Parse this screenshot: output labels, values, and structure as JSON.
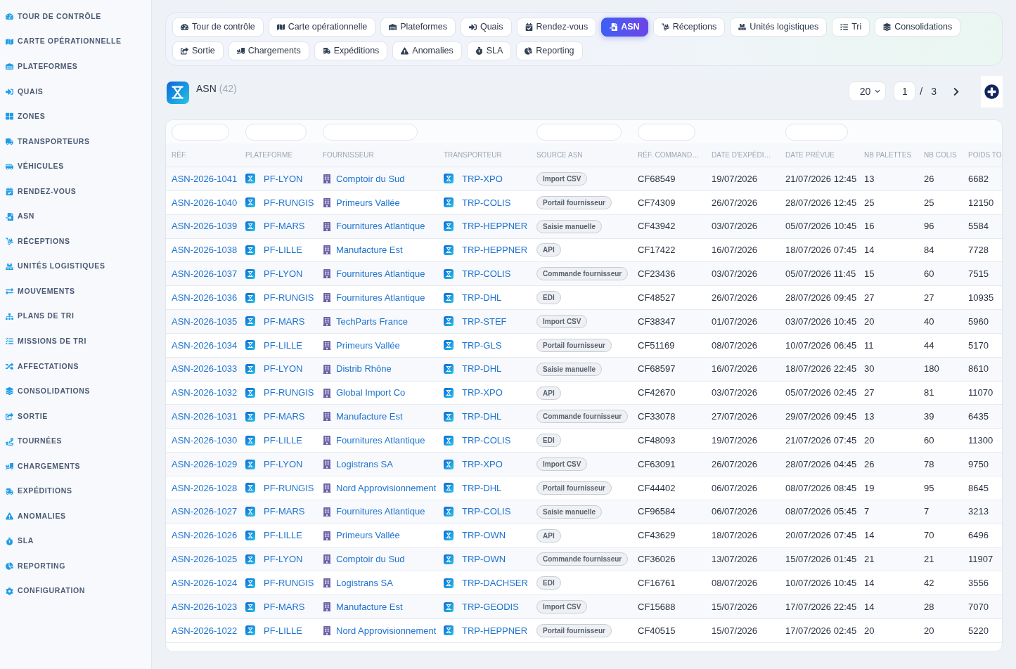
{
  "sidebar": {
    "items": [
      "TOUR DE CONTRÔLE",
      "CARTE OPÉRATIONNELLE",
      "PLATEFORMES",
      "QUAIS",
      "ZONES",
      "TRANSPORTEURS",
      "VÉHICULES",
      "RENDEZ-VOUS",
      "ASN",
      "RÉCEPTIONS",
      "UNITÉS LOGISTIQUES",
      "MOUVEMENTS",
      "PLANS DE TRI",
      "MISSIONS DE TRI",
      "AFFECTATIONS",
      "CONSOLIDATIONS",
      "SORTIE",
      "TOURNÉES",
      "CHARGEMENTS",
      "EXPÉDITIONS",
      "ANOMALIES",
      "SLA",
      "REPORTING",
      "CONFIGURATION"
    ]
  },
  "tabs": [
    {
      "label": "Tour de contrôle",
      "selected": false
    },
    {
      "label": "Carte opérationnelle",
      "selected": false
    },
    {
      "label": "Plateformes",
      "selected": false
    },
    {
      "label": "Quais",
      "selected": false
    },
    {
      "label": "Rendez-vous",
      "selected": false
    },
    {
      "label": "ASN",
      "selected": true
    },
    {
      "label": "Réceptions",
      "selected": false
    },
    {
      "label": "Unités logistiques",
      "selected": false
    },
    {
      "label": "Tri",
      "selected": false
    },
    {
      "label": "Consolidations",
      "selected": false
    },
    {
      "label": "Sortie",
      "selected": false
    },
    {
      "label": "Chargements",
      "selected": false
    },
    {
      "label": "Expéditions",
      "selected": false
    },
    {
      "label": "Anomalies",
      "selected": false
    },
    {
      "label": "SLA",
      "selected": false
    },
    {
      "label": "Reporting",
      "selected": false
    }
  ],
  "header": {
    "title": "ASN",
    "count": "(42)",
    "page_size": "20",
    "page": "1",
    "page_separator": "/",
    "page_total": "3"
  },
  "table": {
    "columns": [
      {
        "label": "RÉF.",
        "filter": true
      },
      {
        "label": "PLATEFORME",
        "filter": true
      },
      {
        "label": "FOURNISSEUR",
        "filter": true
      },
      {
        "label": "TRANSPORTEUR",
        "filter": false
      },
      {
        "label": "SOURCE ASN",
        "filter": true
      },
      {
        "label": "RÉF. COMMAND…",
        "filter": true
      },
      {
        "label": "DATE D'EXPÉDI…",
        "filter": false
      },
      {
        "label": "DATE PRÉVUE",
        "filter": true
      },
      {
        "label": "NB PALETTES",
        "filter": false
      },
      {
        "label": "NB COLIS",
        "filter": false
      },
      {
        "label": "POIDS TO",
        "filter": false
      }
    ],
    "rows": [
      {
        "ref": "ASN-2026-1041",
        "platform": "PF-LYON",
        "supplier": "Comptoir du Sud",
        "carrier": "TRP-XPO",
        "source": "Import CSV",
        "order_ref": "CF68549",
        "ship_date": "19/07/2026",
        "due_date": "21/07/2026 12:45",
        "pallets": "13",
        "parcels": "26",
        "weight": "6682"
      },
      {
        "ref": "ASN-2026-1040",
        "platform": "PF-RUNGIS",
        "supplier": "Primeurs Vallée",
        "carrier": "TRP-COLIS",
        "source": "Portail fournisseur",
        "order_ref": "CF74309",
        "ship_date": "26/07/2026",
        "due_date": "28/07/2026 12:45",
        "pallets": "25",
        "parcels": "25",
        "weight": "12150"
      },
      {
        "ref": "ASN-2026-1039",
        "platform": "PF-MARS",
        "supplier": "Fournitures Atlantique",
        "carrier": "TRP-HEPPNER",
        "source": "Saisie manuelle",
        "order_ref": "CF43942",
        "ship_date": "03/07/2026",
        "due_date": "05/07/2026 10:45",
        "pallets": "16",
        "parcels": "96",
        "weight": "5584"
      },
      {
        "ref": "ASN-2026-1038",
        "platform": "PF-LILLE",
        "supplier": "Manufacture Est",
        "carrier": "TRP-HEPPNER",
        "source": "API",
        "order_ref": "CF17422",
        "ship_date": "16/07/2026",
        "due_date": "18/07/2026 07:45",
        "pallets": "14",
        "parcels": "84",
        "weight": "7728"
      },
      {
        "ref": "ASN-2026-1037",
        "platform": "PF-LYON",
        "supplier": "Fournitures Atlantique",
        "carrier": "TRP-COLIS",
        "source": "Commande fournisseur",
        "order_ref": "CF23436",
        "ship_date": "03/07/2026",
        "due_date": "05/07/2026 11:45",
        "pallets": "15",
        "parcels": "60",
        "weight": "7515"
      },
      {
        "ref": "ASN-2026-1036",
        "platform": "PF-RUNGIS",
        "supplier": "Fournitures Atlantique",
        "carrier": "TRP-DHL",
        "source": "EDI",
        "order_ref": "CF48527",
        "ship_date": "26/07/2026",
        "due_date": "28/07/2026 09:45",
        "pallets": "27",
        "parcels": "27",
        "weight": "10935"
      },
      {
        "ref": "ASN-2026-1035",
        "platform": "PF-MARS",
        "supplier": "TechParts France",
        "carrier": "TRP-STEF",
        "source": "Import CSV",
        "order_ref": "CF38347",
        "ship_date": "01/07/2026",
        "due_date": "03/07/2026 10:45",
        "pallets": "20",
        "parcels": "40",
        "weight": "5960"
      },
      {
        "ref": "ASN-2026-1034",
        "platform": "PF-LILLE",
        "supplier": "Primeurs Vallée",
        "carrier": "TRP-GLS",
        "source": "Portail fournisseur",
        "order_ref": "CF51169",
        "ship_date": "08/07/2026",
        "due_date": "10/07/2026 06:45",
        "pallets": "11",
        "parcels": "44",
        "weight": "5170"
      },
      {
        "ref": "ASN-2026-1033",
        "platform": "PF-LYON",
        "supplier": "Distrib Rhône",
        "carrier": "TRP-DHL",
        "source": "Saisie manuelle",
        "order_ref": "CF68597",
        "ship_date": "16/07/2026",
        "due_date": "18/07/2026 22:45",
        "pallets": "30",
        "parcels": "180",
        "weight": "8610"
      },
      {
        "ref": "ASN-2026-1032",
        "platform": "PF-RUNGIS",
        "supplier": "Global Import Co",
        "carrier": "TRP-XPO",
        "source": "API",
        "order_ref": "CF42670",
        "ship_date": "03/07/2026",
        "due_date": "05/07/2026 02:45",
        "pallets": "27",
        "parcels": "81",
        "weight": "11070"
      },
      {
        "ref": "ASN-2026-1031",
        "platform": "PF-MARS",
        "supplier": "Manufacture Est",
        "carrier": "TRP-DHL",
        "source": "Commande fournisseur",
        "order_ref": "CF33078",
        "ship_date": "27/07/2026",
        "due_date": "29/07/2026 09:45",
        "pallets": "13",
        "parcels": "39",
        "weight": "6435"
      },
      {
        "ref": "ASN-2026-1030",
        "platform": "PF-LILLE",
        "supplier": "Fournitures Atlantique",
        "carrier": "TRP-COLIS",
        "source": "EDI",
        "order_ref": "CF48093",
        "ship_date": "19/07/2026",
        "due_date": "21/07/2026 07:45",
        "pallets": "20",
        "parcels": "60",
        "weight": "11300"
      },
      {
        "ref": "ASN-2026-1029",
        "platform": "PF-LYON",
        "supplier": "Logistrans SA",
        "carrier": "TRP-XPO",
        "source": "Import CSV",
        "order_ref": "CF63091",
        "ship_date": "26/07/2026",
        "due_date": "28/07/2026 04:45",
        "pallets": "26",
        "parcels": "78",
        "weight": "9750"
      },
      {
        "ref": "ASN-2026-1028",
        "platform": "PF-RUNGIS",
        "supplier": "Nord Approvisionnement",
        "carrier": "TRP-DHL",
        "source": "Portail fournisseur",
        "order_ref": "CF44402",
        "ship_date": "06/07/2026",
        "due_date": "08/07/2026 08:45",
        "pallets": "19",
        "parcels": "95",
        "weight": "8645"
      },
      {
        "ref": "ASN-2026-1027",
        "platform": "PF-MARS",
        "supplier": "Fournitures Atlantique",
        "carrier": "TRP-COLIS",
        "source": "Saisie manuelle",
        "order_ref": "CF96584",
        "ship_date": "06/07/2026",
        "due_date": "08/07/2026 05:45",
        "pallets": "7",
        "parcels": "7",
        "weight": "3213"
      },
      {
        "ref": "ASN-2026-1026",
        "platform": "PF-LILLE",
        "supplier": "Primeurs Vallée",
        "carrier": "TRP-OWN",
        "source": "API",
        "order_ref": "CF43629",
        "ship_date": "18/07/2026",
        "due_date": "20/07/2026 07:45",
        "pallets": "14",
        "parcels": "70",
        "weight": "6496"
      },
      {
        "ref": "ASN-2026-1025",
        "platform": "PF-LYON",
        "supplier": "Comptoir du Sud",
        "carrier": "TRP-OWN",
        "source": "Commande fournisseur",
        "order_ref": "CF36026",
        "ship_date": "13/07/2026",
        "due_date": "15/07/2026 01:45",
        "pallets": "21",
        "parcels": "21",
        "weight": "11907"
      },
      {
        "ref": "ASN-2026-1024",
        "platform": "PF-RUNGIS",
        "supplier": "Logistrans SA",
        "carrier": "TRP-DACHSER",
        "source": "EDI",
        "order_ref": "CF16761",
        "ship_date": "08/07/2026",
        "due_date": "10/07/2026 10:45",
        "pallets": "14",
        "parcels": "42",
        "weight": "3556"
      },
      {
        "ref": "ASN-2026-1023",
        "platform": "PF-MARS",
        "supplier": "Manufacture Est",
        "carrier": "TRP-GEODIS",
        "source": "Import CSV",
        "order_ref": "CF15688",
        "ship_date": "15/07/2026",
        "due_date": "17/07/2026 22:45",
        "pallets": "14",
        "parcels": "28",
        "weight": "7070"
      },
      {
        "ref": "ASN-2026-1022",
        "platform": "PF-LILLE",
        "supplier": "Nord Approvisionnement",
        "carrier": "TRP-HEPPNER",
        "source": "Portail fournisseur",
        "order_ref": "CF40515",
        "ship_date": "15/07/2026",
        "due_date": "17/07/2026 02:45",
        "pallets": "20",
        "parcels": "20",
        "weight": "5220"
      }
    ]
  }
}
